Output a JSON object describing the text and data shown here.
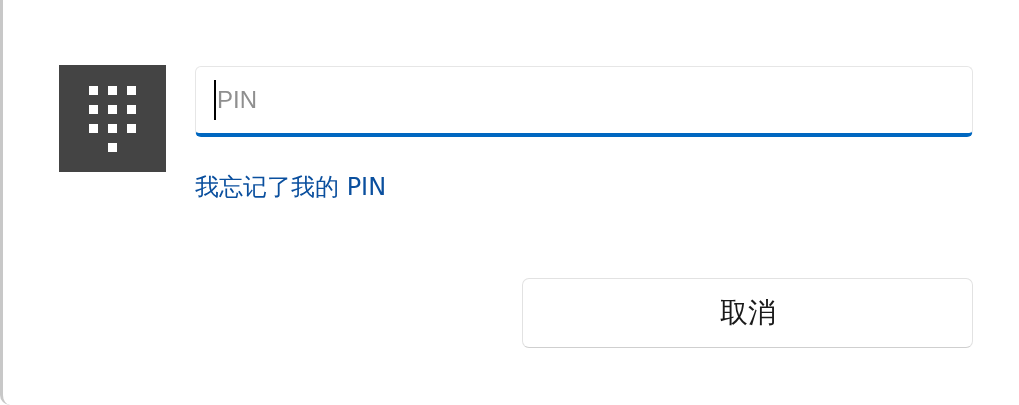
{
  "pin_field": {
    "placeholder": "PIN",
    "focused": true
  },
  "forgot_link": "我忘记了我的 PIN",
  "buttons": [
    {
      "label": "取消"
    }
  ]
}
